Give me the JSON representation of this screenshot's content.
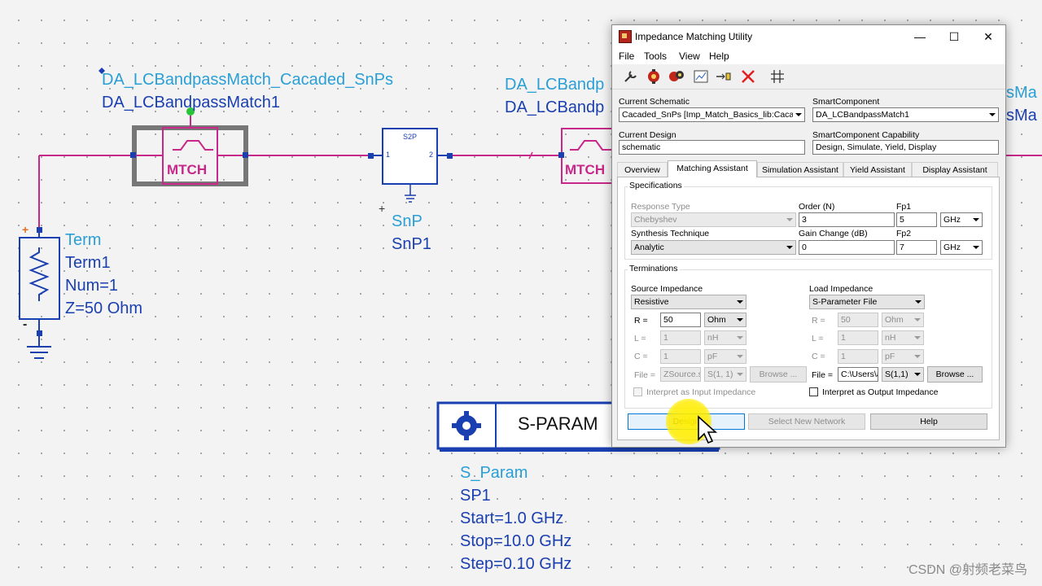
{
  "schematic": {
    "left_block": {
      "label_line1": "DA_LCBandpassMatch_Cacaded_SnPs",
      "label_line2": "DA_LCBandpassMatch1",
      "symbol_text": "MTCH"
    },
    "right_block": {
      "label_line1": "DA_LCBandp",
      "label_line2": "DA_LCBandp",
      "symbol_text": "MTCH",
      "edge_text_1": "sMa",
      "edge_text_2": "sMa"
    },
    "s2p": {
      "box_text": "S2P",
      "port1": "1",
      "port2": "2",
      "plus": "+",
      "label_line1": "SnP",
      "label_line2": "SnP1"
    },
    "term": {
      "plus": "+",
      "minus": "-",
      "lines": [
        "Term",
        "Term1",
        "Num=1",
        "Z=50 Ohm"
      ]
    },
    "sparam": {
      "title": "S-PARAM",
      "lines": [
        "S_Param",
        "SP1",
        "Start=1.0 GHz",
        "Stop=10.0 GHz",
        "Step=0.10 GHz"
      ]
    },
    "watermark": "CSDN @射频老菜鸟"
  },
  "dialog": {
    "title": "Impedance Matching Utility",
    "window_buttons": [
      "—",
      "☐",
      "✕"
    ],
    "menu": [
      "File",
      "Tools",
      "View",
      "Help"
    ],
    "toolbar_icons": [
      "wrench-icon",
      "gear-red-icon",
      "gear-multi-icon",
      "graph-icon",
      "arrows-icon",
      "delete-icon",
      "grid-icon"
    ],
    "current_schematic_label": "Current Schematic",
    "current_schematic_value": "Cacaded_SnPs [Imp_Match_Basics_lib:Cacade",
    "smartcomponent_label": "SmartComponent",
    "smartcomponent_value": "DA_LCBandpassMatch1",
    "current_design_label": "Current Design",
    "current_design_value": "schematic",
    "capability_label": "SmartComponent Capability",
    "capability_value": "Design, Simulate, Yield, Display",
    "tabs": [
      "Overview",
      "Matching Assistant",
      "Simulation Assistant",
      "Yield Assistant",
      "Display Assistant"
    ],
    "active_tab": "Matching Assistant",
    "specs": {
      "group_title": "Specifications",
      "response_type_label": "Response Type",
      "response_type_value": "Chebyshev",
      "order_label": "Order (N)",
      "order_value": "3",
      "fp1_label": "Fp1",
      "fp1_value": "5",
      "fp1_unit": "GHz",
      "synthesis_label": "Synthesis Technique",
      "synthesis_value": "Analytic",
      "gain_label": "Gain Change (dB)",
      "gain_value": "0",
      "fp2_label": "Fp2",
      "fp2_value": "7",
      "fp2_unit": "GHz"
    },
    "terms": {
      "group_title": "Terminations",
      "source_label": "Source Impedance",
      "source_type": "Resistive",
      "load_label": "Load Impedance",
      "load_type": "S-Parameter File",
      "r_label": "R =",
      "l_label": "L =",
      "c_label": "C =",
      "file_label": "File =",
      "src_r": "50",
      "src_r_unit": "Ohm",
      "src_l": "1",
      "src_l_unit": "nH",
      "src_c": "1",
      "src_c_unit": "pF",
      "src_file": "ZSource.s1",
      "src_param": "S(1, 1)",
      "browse": "Browse ...",
      "load_r": "50",
      "load_r_unit": "Ohm",
      "load_l": "1",
      "load_l_unit": "nH",
      "load_c": "1",
      "load_c_unit": "pF",
      "load_file": "C:\\Users\\a",
      "load_param": "S(1,1)",
      "interp_input": "Interpret as Input Impedance",
      "interp_output": "Interpret as Output Impedance"
    },
    "buttons": {
      "design": "Design",
      "select_new": "Select New Network",
      "help": "Help"
    }
  }
}
